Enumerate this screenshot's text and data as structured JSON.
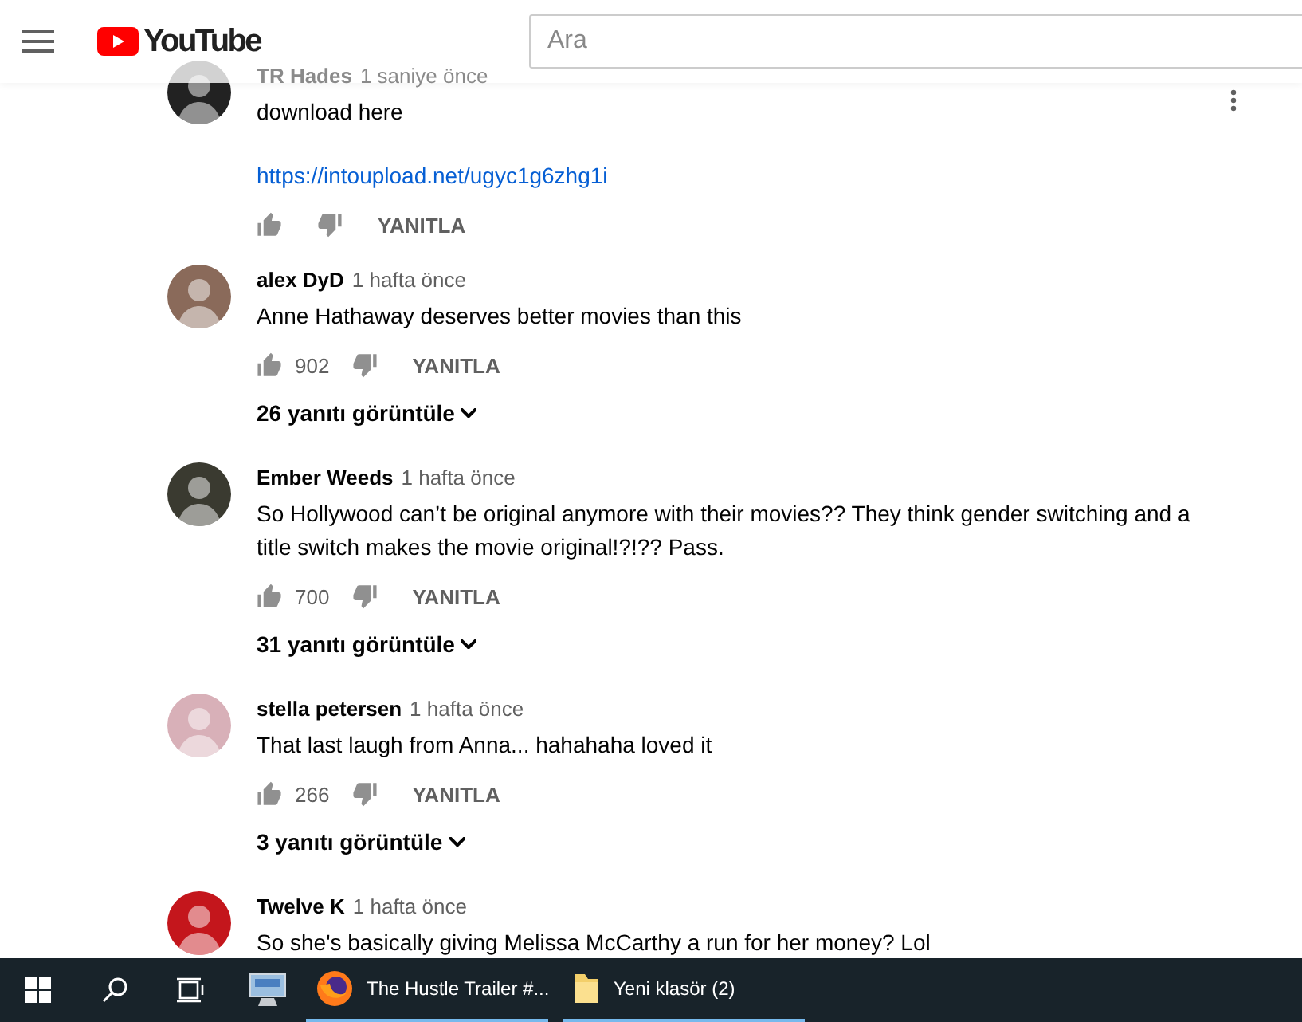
{
  "header": {
    "logo_text": "YouTube",
    "search": {
      "placeholder": "Ara"
    }
  },
  "comments": [
    {
      "author": "TR Hades",
      "time": "1 saniye önce",
      "body": "download here",
      "link": "https://intoupload.net/ugyc1g6zhg1i",
      "reply_label": "YANITLA",
      "menu": true
    },
    {
      "author": "alex DyD",
      "time": "1 hafta önce",
      "body": "Anne Hathaway deserves better movies than this",
      "likes": "902",
      "reply_label": "YANITLA",
      "replies": "26 yanıtı görüntüle"
    },
    {
      "author": "Ember Weeds",
      "time": "1 hafta önce",
      "body": "So Hollywood can’t be original anymore with their movies?? They think gender switching and a title switch makes the movie original!?!?? Pass.",
      "likes": "700",
      "reply_label": "YANITLA",
      "replies": "31 yanıtı görüntüle"
    },
    {
      "author": "stella petersen",
      "time": "1 hafta önce",
      "body": "That last laugh from Anna... hahahaha loved it",
      "likes": "266",
      "reply_label": "YANITLA",
      "replies": "3 yanıtı görüntüle"
    },
    {
      "author": "Twelve K",
      "time": "1 hafta önce",
      "body": "So she's basically giving Melissa McCarthy a run for her money? Lol"
    }
  ],
  "taskbar": {
    "tasks": [
      {
        "kind": "firefox",
        "label": "The Hustle Trailer #..."
      },
      {
        "kind": "folder",
        "label": "Yeni klasör (2)"
      }
    ]
  }
}
